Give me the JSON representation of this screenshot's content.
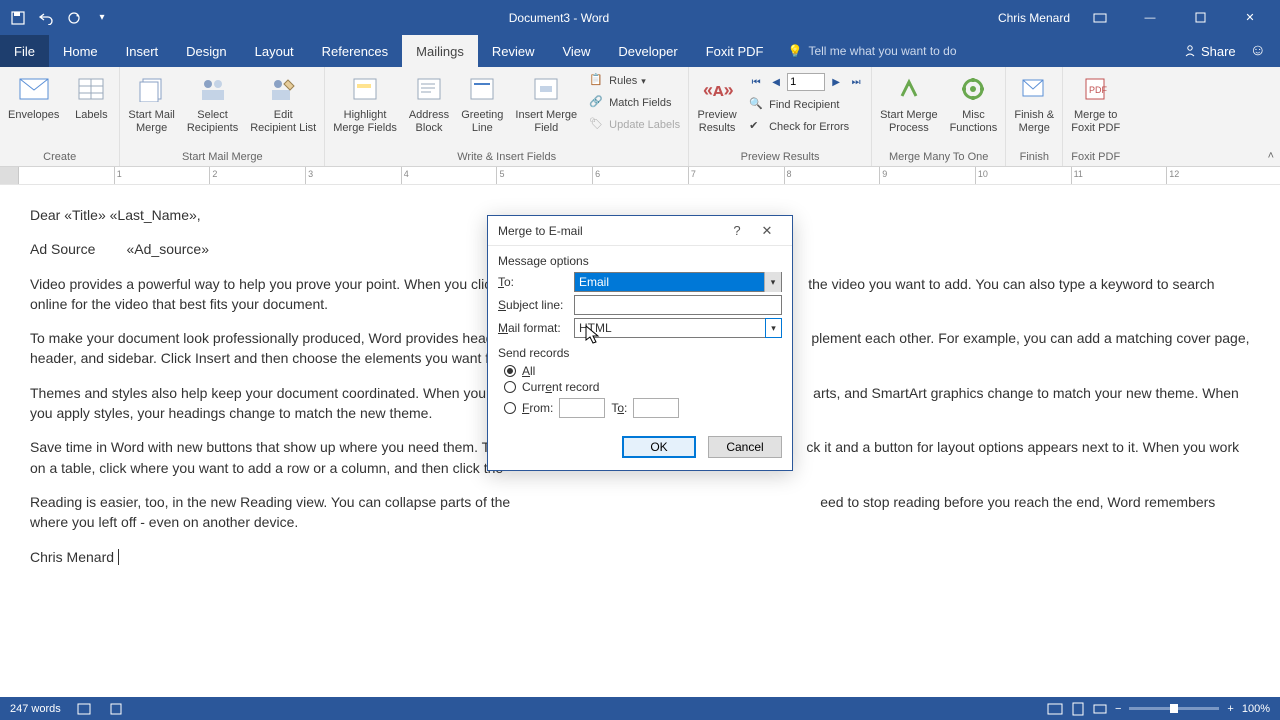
{
  "app": {
    "title": "Document3 - Word",
    "user": "Chris Menard"
  },
  "tabs": [
    "File",
    "Home",
    "Insert",
    "Design",
    "Layout",
    "References",
    "Mailings",
    "Review",
    "View",
    "Developer",
    "Foxit PDF"
  ],
  "active_tab": "Mailings",
  "tellme": "Tell me what you want to do",
  "share": "Share",
  "ribbon": {
    "groups": {
      "create": {
        "label": "Create",
        "envelopes": "Envelopes",
        "labels": "Labels"
      },
      "start": {
        "label": "Start Mail Merge",
        "start": "Start Mail\nMerge",
        "select": "Select\nRecipients",
        "edit": "Edit\nRecipient List"
      },
      "write": {
        "label": "Write & Insert Fields",
        "highlight": "Highlight\nMerge Fields",
        "address": "Address\nBlock",
        "greeting": "Greeting\nLine",
        "insert": "Insert Merge\nField",
        "rules": "Rules",
        "match": "Match Fields",
        "update": "Update Labels"
      },
      "preview": {
        "label": "Preview Results",
        "preview": "Preview\nResults",
        "record": "1",
        "find": "Find Recipient",
        "check": "Check for Errors"
      },
      "mergemany": {
        "label": "Merge Many To One",
        "start": "Start Merge\nProcess",
        "misc": "Misc\nFunctions"
      },
      "finish": {
        "label": "Finish",
        "finish": "Finish &\nMerge"
      },
      "foxit": {
        "label": "Foxit PDF",
        "merge": "Merge to\nFoxit PDF"
      }
    }
  },
  "document": {
    "greeting_prefix": "Dear ",
    "greeting_fields": "«Title» «Last_Name»,",
    "ad_label": "Ad Source",
    "ad_field": "«Ad_source»",
    "p1a": "Video provides a powerful way to help you prove your point. When you click",
    "p1b": "the video you want to add. You can also type a keyword to search online for the video that best fits your document.",
    "p2a": "To make your document look professionally produced, Word provides heade",
    "p2b": "plement each other. For example, you can add a matching cover page, header, and sidebar. Click Insert and then choose the elements you want fro",
    "p3a": "Themes and styles also help keep your document coordinated. When you cli",
    "p3b": "arts, and SmartArt graphics change to match your new theme. When you apply styles, your headings change to match the new theme.",
    "p4a": "Save time in Word with new buttons that show up where you need them. To",
    "p4b": "ck it and a button for layout options appears next to it. When you work on a table, click where you want to add a row or a column, and then click the",
    "p5a": "Reading is easier, too, in the new Reading view. You can collapse parts of the",
    "p5b": "eed to stop reading before you reach the end, Word remembers where you left off - even on another device.",
    "signature": "Chris Menard"
  },
  "dialog": {
    "title": "Merge to E-mail",
    "section1": "Message options",
    "to_label": "To:",
    "to_value": "Email",
    "subject_label": "Subject line:",
    "subject_value": "",
    "mail_label": "Mail format:",
    "mail_value": "HTML",
    "section2": "Send records",
    "all": "All",
    "current": "Current record",
    "from": "From:",
    "to2": "To:",
    "from_value": "",
    "to2_value": "",
    "ok": "OK",
    "cancel": "Cancel"
  },
  "statusbar": {
    "words": "247 words",
    "zoom": "100%"
  },
  "ruler_marks": [
    "",
    "1",
    "2",
    "3",
    "4",
    "5",
    "6",
    "7",
    "8",
    "9",
    "10",
    "11",
    "12"
  ]
}
